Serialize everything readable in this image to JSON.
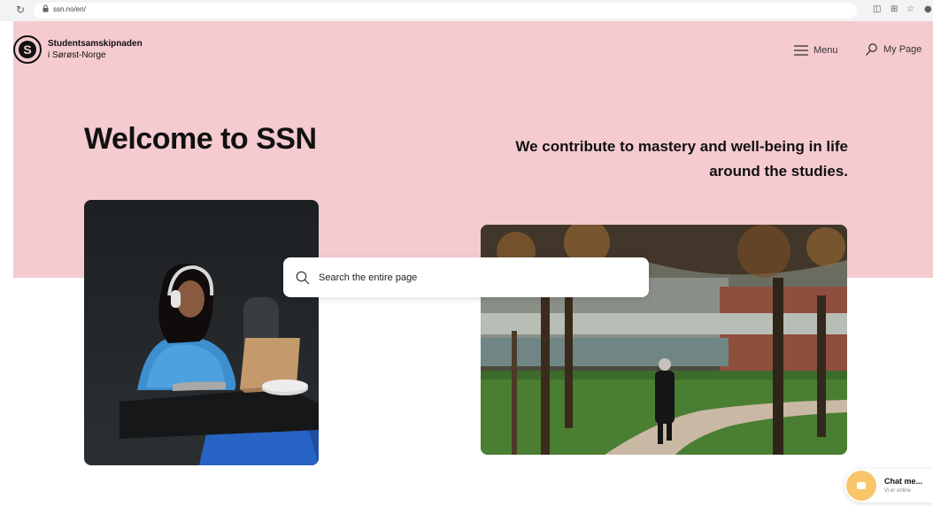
{
  "browser": {
    "url": "ssn.no/en/",
    "reload_icon": "reload-icon",
    "ext_icons": [
      "translate-icon",
      "extension-icon",
      "star-icon",
      "profile-icon"
    ]
  },
  "header": {
    "brand_line1": "Studentsamskipnaden",
    "brand_line2": "i Sørøst-Norge",
    "menu_label": "Menu",
    "mypage_label": "My Page"
  },
  "hero": {
    "title": "Welcome to SSN",
    "tagline": "We contribute to mastery and well-being in life around the studies."
  },
  "search": {
    "placeholder": "Search the entire page"
  },
  "chat": {
    "title": "Chat me...",
    "status": "Vi er online"
  },
  "colors": {
    "hero_bg": "#f5cbd0",
    "chat_accent": "#f7c66b"
  }
}
